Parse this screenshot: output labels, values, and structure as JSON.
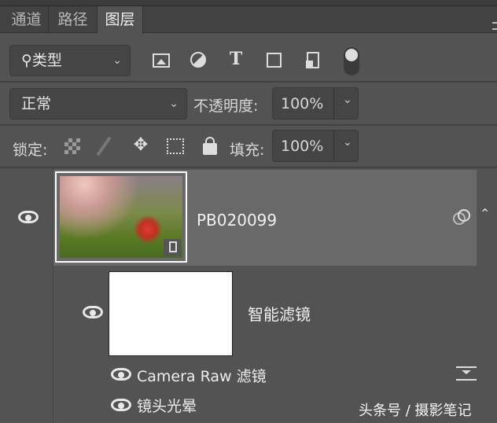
{
  "tabs": [
    {
      "label": "通道"
    },
    {
      "label": "路径"
    },
    {
      "label": "图层",
      "active": true
    }
  ],
  "filter": {
    "search_icon": "⚲",
    "value": "类型"
  },
  "filter_icons": [
    "image-filter-icon",
    "adjustment-filter-icon",
    "type-filter-icon",
    "shape-filter-icon",
    "smart-object-filter-icon",
    "filter-toggle"
  ],
  "blend": {
    "value": "正常"
  },
  "opacity": {
    "label": "不透明度:",
    "value": "100%"
  },
  "lock": {
    "label": "锁定:"
  },
  "fill": {
    "label": "填充:",
    "value": "100%"
  },
  "layer": {
    "name": "PB020099"
  },
  "smart_filters": {
    "label": "智能滤镜",
    "items": [
      {
        "label": "Camera Raw 滤镜"
      },
      {
        "label": "镜头光晕"
      }
    ]
  },
  "watermark": "头条号 / 摄影笔记",
  "colors": {
    "panel": "#535353",
    "selected": "#6a696a"
  }
}
